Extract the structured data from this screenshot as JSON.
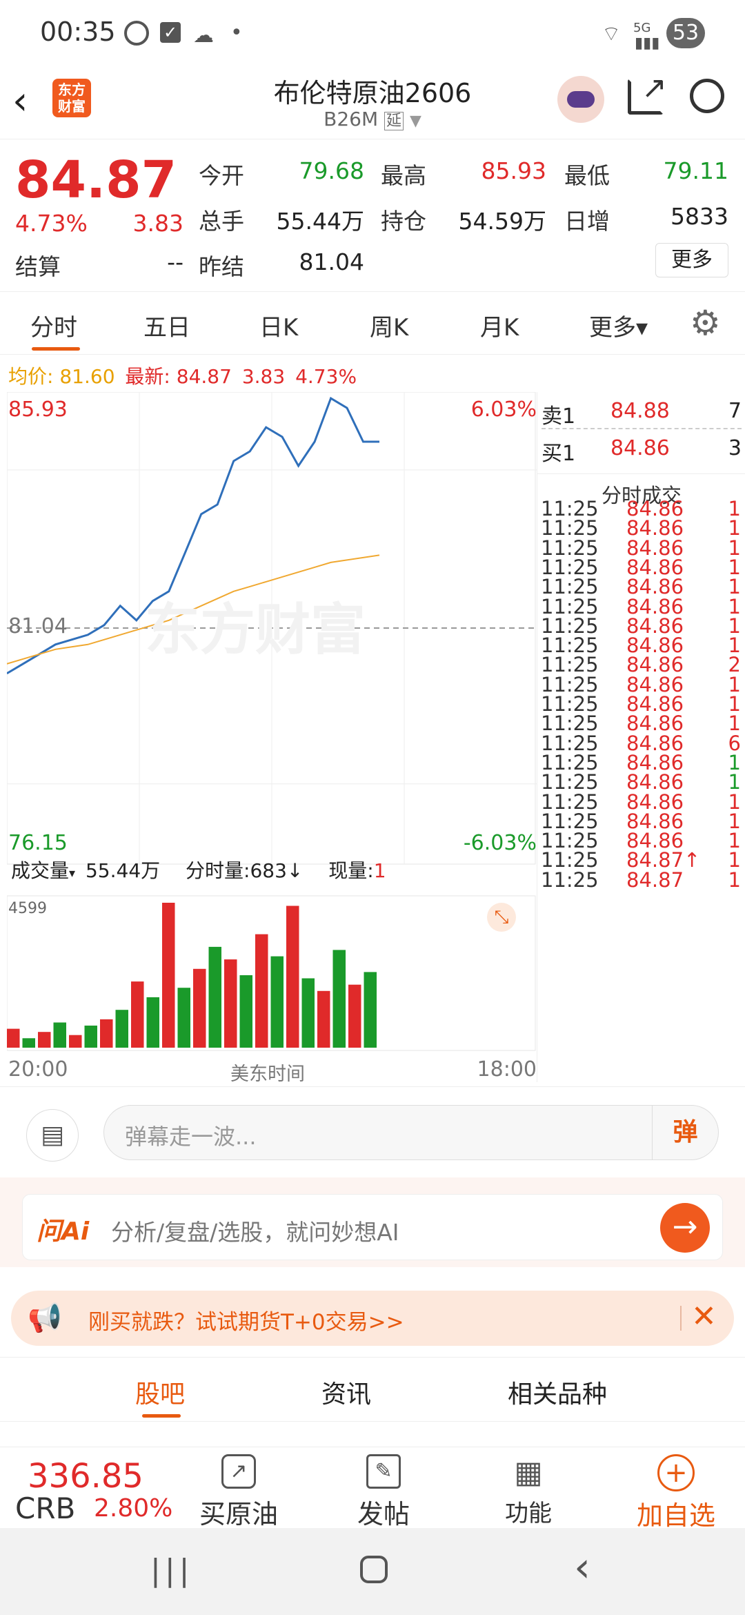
{
  "status_bar": {
    "time": "00:35",
    "battery": "53",
    "network": "5G"
  },
  "header": {
    "title": "布伦特原油2606",
    "code": "B26M",
    "delay_tag": "延",
    "logo_text": "东方财富"
  },
  "quote": {
    "price": "84.87",
    "pct": "4.73%",
    "change": "3.83",
    "settle_label": "结算",
    "settle_value": "--",
    "open_label": "今开",
    "open_value": "79.68",
    "high_label": "最高",
    "high_value": "85.93",
    "low_label": "最低",
    "low_value": "79.11",
    "vol_label": "总手",
    "vol_value": "55.44万",
    "oi_label": "持仓",
    "oi_value": "54.59万",
    "daily_label": "日增",
    "daily_value": "5833",
    "prev_label": "昨结",
    "prev_value": "81.04",
    "more_button": "更多"
  },
  "tabs": [
    "分时",
    "五日",
    "日K",
    "周K",
    "月K",
    "更多▾"
  ],
  "info_line": {
    "avg_label": "均价:",
    "avg_value": "81.60",
    "last_label": "最新:",
    "last_value": "84.87",
    "change": "3.83",
    "pct": "4.73%"
  },
  "chart": {
    "y_max": "85.93",
    "y_min": "76.15",
    "y_mid": "81.04",
    "pct_max": "6.03%",
    "pct_min": "-6.03%",
    "x_start": "20:00",
    "x_mid": "美东时间",
    "x_end": "18:00",
    "watermark": "东方财富",
    "vol_label": "成交量",
    "vol_total": "55.44万",
    "vol_minute_label": "分时量:",
    "vol_minute_value": "683↓",
    "vol_now_label": "现量:",
    "vol_now_value": "1",
    "vol_axis_max": "4599"
  },
  "chart_data": {
    "type": "line",
    "series": [
      {
        "name": "最新",
        "values": [
          80.1,
          80.3,
          80.5,
          80.7,
          80.8,
          80.9,
          81.1,
          81.5,
          81.2,
          81.6,
          81.8,
          82.6,
          83.4,
          83.6,
          84.5,
          84.7,
          85.2,
          85.0,
          84.4,
          84.9,
          85.8,
          85.6,
          84.9,
          84.9
        ]
      },
      {
        "name": "均价",
        "values": [
          80.3,
          80.4,
          80.5,
          80.6,
          80.65,
          80.7,
          80.8,
          80.9,
          81.0,
          81.1,
          81.2,
          81.35,
          81.5,
          81.65,
          81.8,
          81.9,
          82.0,
          82.1,
          82.2,
          82.3,
          82.4,
          82.45,
          82.5,
          82.55
        ]
      }
    ],
    "ylim": [
      76.15,
      85.93
    ],
    "volume": [
      600,
      300,
      500,
      800,
      400,
      700,
      900,
      1200,
      2100,
      1600,
      4599,
      1900,
      2500,
      3200,
      2800,
      2300,
      3600,
      2900,
      4500,
      2200,
      1800,
      3100,
      2000,
      2400
    ]
  },
  "order_book": {
    "sell_label": "卖1",
    "sell_price": "84.88",
    "sell_qty": "7",
    "buy_label": "买1",
    "buy_price": "84.86",
    "buy_qty": "3",
    "trades_title": "分时成交"
  },
  "trades": [
    {
      "t": "11:25",
      "p": "84.86",
      "q": "1"
    },
    {
      "t": "11:25",
      "p": "84.86",
      "q": "1"
    },
    {
      "t": "11:25",
      "p": "84.86",
      "q": "1"
    },
    {
      "t": "11:25",
      "p": "84.86",
      "q": "1"
    },
    {
      "t": "11:25",
      "p": "84.86",
      "q": "1"
    },
    {
      "t": "11:25",
      "p": "84.86",
      "q": "1"
    },
    {
      "t": "11:25",
      "p": "84.86",
      "q": "1"
    },
    {
      "t": "11:25",
      "p": "84.86",
      "q": "1"
    },
    {
      "t": "11:25",
      "p": "84.86",
      "q": "2"
    },
    {
      "t": "11:25",
      "p": "84.86",
      "q": "1"
    },
    {
      "t": "11:25",
      "p": "84.86",
      "q": "1"
    },
    {
      "t": "11:25",
      "p": "84.86",
      "q": "1"
    },
    {
      "t": "11:25",
      "p": "84.86",
      "q": "6"
    },
    {
      "t": "11:25",
      "p": "84.86",
      "q": "1"
    },
    {
      "t": "11:25",
      "p": "84.86",
      "q": "1"
    },
    {
      "t": "11:25",
      "p": "84.86",
      "q": "1"
    },
    {
      "t": "11:25",
      "p": "84.86",
      "q": "1"
    },
    {
      "t": "11:25",
      "p": "84.86",
      "q": "1"
    },
    {
      "t": "11:25",
      "p": "84.87↑",
      "q": "1"
    },
    {
      "t": "11:25",
      "p": "84.87",
      "q": "1"
    }
  ],
  "danmu": {
    "placeholder": "弹幕走一波...",
    "button": "弹"
  },
  "ai": {
    "logo": "问Ai",
    "text": "分析/复盘/选股，就问妙想AI"
  },
  "promo": {
    "text": "刚买就跌？试试期货T+0交易>>"
  },
  "bottom_tabs": [
    "股吧",
    "资讯",
    "相关品种"
  ],
  "footer": {
    "index_value": "336.85",
    "index_name": "CRB",
    "index_pct": "2.80%",
    "buy_label": "买原油",
    "post_label": "发帖",
    "func_label": "功能",
    "add_label": "加自选"
  }
}
